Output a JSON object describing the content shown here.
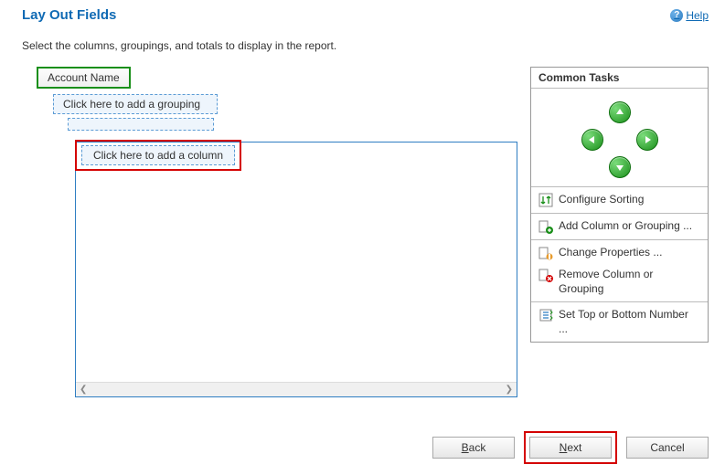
{
  "header": {
    "title": "Lay  Out  Fields",
    "help_label": "Help"
  },
  "instruction": "Select the columns, groupings, and totals to display in the report.",
  "fields": {
    "account_name": "Account Name",
    "add_grouping": "Click here to add a grouping",
    "add_column": "Click here to add a column"
  },
  "common_tasks": {
    "header": "Common Tasks",
    "items": {
      "configure_sorting": "Configure Sorting",
      "add_column": "Add Column or Grouping ...",
      "change_props": "Change Properties ...",
      "remove_column": "Remove Column or Grouping",
      "set_top_bottom": "Set Top or Bottom Number ..."
    }
  },
  "buttons": {
    "back": "Back",
    "next": "Next",
    "cancel": "Cancel"
  }
}
